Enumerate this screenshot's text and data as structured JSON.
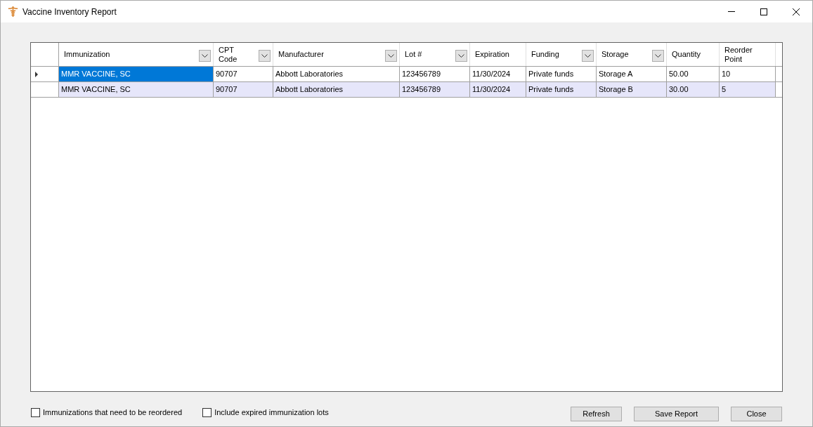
{
  "window": {
    "title": "Vaccine Inventory Report"
  },
  "table": {
    "columns": [
      {
        "label": "Immunization",
        "filter": true
      },
      {
        "label": "CPT Code",
        "filter": true
      },
      {
        "label": "Manufacturer",
        "filter": true
      },
      {
        "label": "Lot #",
        "filter": true
      },
      {
        "label": "Expiration",
        "filter": false
      },
      {
        "label": "Funding",
        "filter": true
      },
      {
        "label": "Storage",
        "filter": true
      },
      {
        "label": "Quantity",
        "filter": false
      },
      {
        "label": "Reorder Point",
        "filter": false
      }
    ],
    "rows": [
      {
        "selected": true,
        "cells": [
          "MMR VACCINE, SC",
          "90707",
          "Abbott Laboratories",
          "123456789",
          "11/30/2024",
          "Private funds",
          "Storage A",
          "50.00",
          "10"
        ]
      },
      {
        "selected": false,
        "cells": [
          "MMR VACCINE, SC",
          "90707",
          "Abbott Laboratories",
          "123456789",
          "11/30/2024",
          "Private funds",
          "Storage B",
          "30.00",
          "5"
        ]
      }
    ]
  },
  "options": [
    {
      "label": "Immunizations that need to be reordered",
      "checked": false
    },
    {
      "label": "Include expired immunization lots",
      "checked": false
    }
  ],
  "buttons": [
    "Refresh",
    "Save Report",
    "Close"
  ]
}
